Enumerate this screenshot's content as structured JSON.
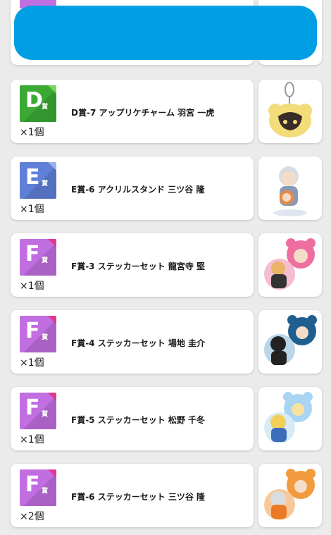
{
  "top_item": {
    "partial": true
  },
  "items": [
    {
      "grade": "D",
      "grade_suffix": "賞",
      "name": "D賞-7 アップリケチャーム 羽宮 一虎",
      "qty": "×1個",
      "color": "#3aaa35",
      "corner": "#7dd25a",
      "image": "charm-keychain-icon"
    },
    {
      "grade": "E",
      "grade_suffix": "賞",
      "name": "E賞-6 アクリルスタンド 三ツ谷 隆",
      "qty": "×1個",
      "color": "#5f7fd8",
      "corner": "#9db1ee",
      "image": "acrylic-stand-icon"
    },
    {
      "grade": "F",
      "grade_suffix": "賞",
      "name": "F賞-3 ステッカーセット 龍宮寺 堅",
      "qty": "×1個",
      "color": "#c06ee0",
      "corner": "#e4398a",
      "image": "sticker-pink-icon"
    },
    {
      "grade": "F",
      "grade_suffix": "賞",
      "name": "F賞-4 ステッカーセット 場地 圭介",
      "qty": "×1個",
      "color": "#c06ee0",
      "corner": "#e4398a",
      "image": "sticker-navy-icon"
    },
    {
      "grade": "F",
      "grade_suffix": "賞",
      "name": "F賞-5 ステッカーセット 松野 千冬",
      "qty": "×1個",
      "color": "#c06ee0",
      "corner": "#e4398a",
      "image": "sticker-blue-icon"
    },
    {
      "grade": "F",
      "grade_suffix": "賞",
      "name": "F賞-6 ステッカーセット 三ツ谷 隆",
      "qty": "×2個",
      "color": "#c06ee0",
      "corner": "#e4398a",
      "image": "sticker-orange-icon"
    }
  ]
}
